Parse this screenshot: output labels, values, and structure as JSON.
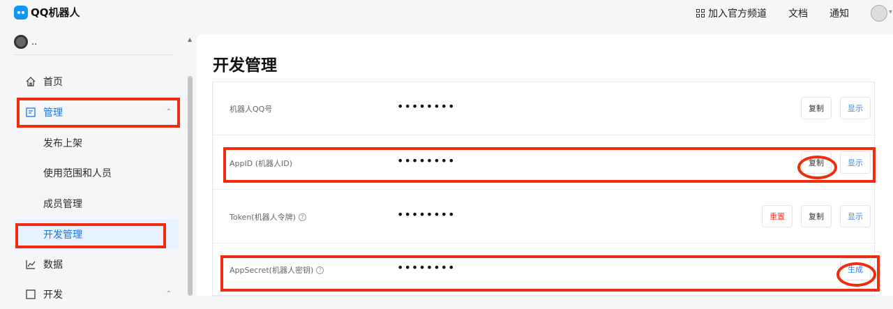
{
  "top": {
    "logo": "QQ机器人",
    "join_channel": "加入官方频道",
    "docs": "文档",
    "notifications": "通知"
  },
  "sidebar": {
    "bot_name": "..",
    "items": [
      {
        "label": "首页",
        "icon": "home-icon"
      },
      {
        "label": "管理",
        "icon": "manage-icon"
      },
      {
        "label": "发布上架"
      },
      {
        "label": "使用范围和人员"
      },
      {
        "label": "成员管理"
      },
      {
        "label": "开发管理"
      },
      {
        "label": "数据",
        "icon": "chart-icon"
      },
      {
        "label": "开发",
        "icon": "develop-icon"
      }
    ]
  },
  "main": {
    "title": "开发管理",
    "rows": [
      {
        "label": "机器人QQ号",
        "value": "••••••••",
        "buttons": [
          "复制",
          "显示"
        ]
      },
      {
        "label": "AppID (机器人ID)",
        "value": "••••••••",
        "buttons": [
          "复制",
          "显示"
        ]
      },
      {
        "label": "Token(机器人令牌)",
        "value": "••••••••",
        "buttons": [
          "重置",
          "复制",
          "显示"
        ]
      },
      {
        "label": "AppSecret(机器人密钥)",
        "value": "••••••••",
        "buttons": [
          "生成"
        ]
      }
    ]
  },
  "colors": {
    "accent": "#1677ff",
    "annotation": "#ef2d0e",
    "danger": "#ff3b30"
  }
}
